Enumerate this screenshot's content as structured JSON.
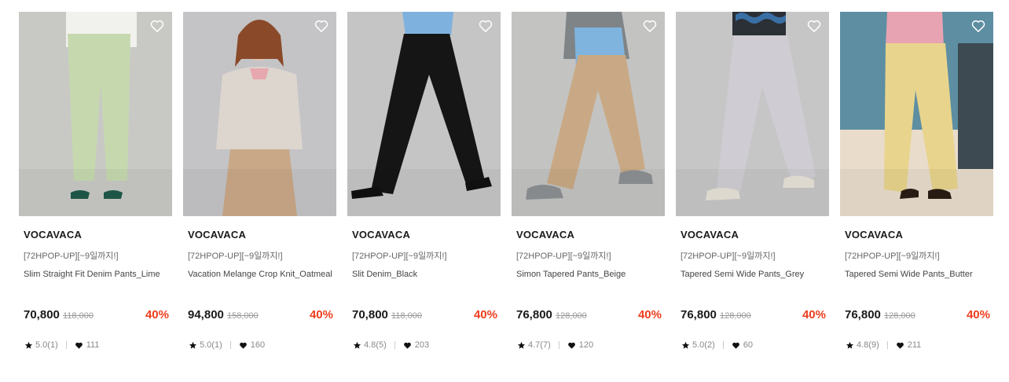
{
  "products": [
    {
      "brand": "VOCAVACA",
      "promo": "[72HPOP-UP][~9일까지!]",
      "name": "Slim Straight Fit Denim Pants_Lime",
      "price": "70,800",
      "original_price": "118,000",
      "discount": "40%",
      "rating": "5.0(1)",
      "likes": "111",
      "image_colors": {
        "bg": "#c8c9c5",
        "garment": "#c6d9ae",
        "top": "#f1f1ee"
      }
    },
    {
      "brand": "VOCAVACA",
      "promo": "[72HPOP-UP][~9일까지!]",
      "name": "Vacation Melange Crop Knit_Oatmeal",
      "price": "94,800",
      "original_price": "158,000",
      "discount": "40%",
      "rating": "5.0(1)",
      "likes": "160",
      "image_colors": {
        "bg": "#c4c4c6",
        "garment": "#c9a888",
        "top": "#ddd6cf"
      }
    },
    {
      "brand": "VOCAVACA",
      "promo": "[72HPOP-UP][~9일까지!]",
      "name": "Slit Denim_Black",
      "price": "70,800",
      "original_price": "118,000",
      "discount": "40%",
      "rating": "4.8(5)",
      "likes": "203",
      "image_colors": {
        "bg": "#c5c5c5",
        "garment": "#151515",
        "top": "#7fb1de"
      }
    },
    {
      "brand": "VOCAVACA",
      "promo": "[72HPOP-UP][~9일까지!]",
      "name": "Simon Tapered Pants_Beige",
      "price": "76,800",
      "original_price": "128,000",
      "discount": "40%",
      "rating": "4.7(7)",
      "likes": "120",
      "image_colors": {
        "bg": "#c3c3c1",
        "garment": "#c9a985",
        "top": "#7fb4df"
      }
    },
    {
      "brand": "VOCAVACA",
      "promo": "[72HPOP-UP][~9일까지!]",
      "name": "Tapered Semi Wide Pants_Grey",
      "price": "76,800",
      "original_price": "128,000",
      "discount": "40%",
      "rating": "5.0(2)",
      "likes": "60",
      "image_colors": {
        "bg": "#c6c6c6",
        "garment": "#d0ccd3",
        "top": "#3a6fa5"
      }
    },
    {
      "brand": "VOCAVACA",
      "promo": "[72HPOP-UP][~9일까지!]",
      "name": "Tapered Semi Wide Pants_Butter",
      "price": "76,800",
      "original_price": "128,000",
      "discount": "40%",
      "rating": "4.8(9)",
      "likes": "211",
      "image_colors": {
        "bg": "#5d8ea2",
        "garment": "#e8d48c",
        "top": "#e8a3b2"
      }
    }
  ],
  "icons": {
    "wishlist": "heart-outline-icon",
    "rating": "star-icon",
    "likes": "heart-filled-icon"
  },
  "colors": {
    "discount": "#ee3d1d",
    "strikethrough": "#999999",
    "brand_text": "#1a1a1a"
  }
}
